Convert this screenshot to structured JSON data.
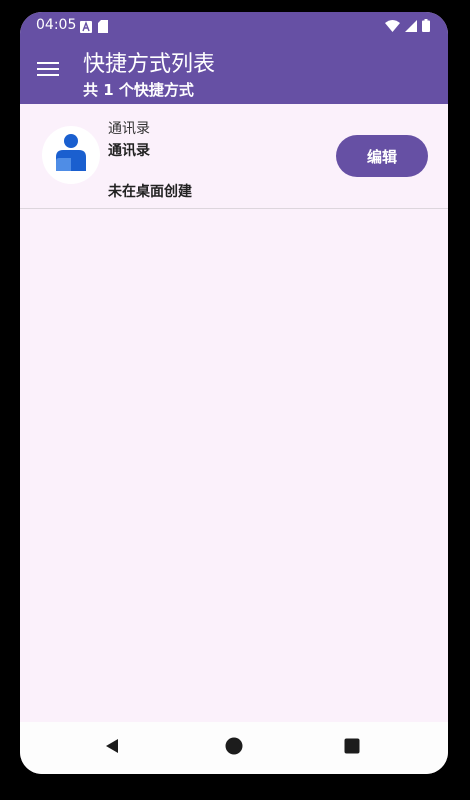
{
  "status_bar": {
    "time": "04:05",
    "left_icons": [
      "font-notification-icon",
      "sd-card-icon"
    ],
    "right_icons": [
      "wifi-icon",
      "signal-icon",
      "battery-icon"
    ]
  },
  "header": {
    "title": "快捷方式列表",
    "subtitle": "共 1 个快捷方式",
    "menu_icon": "hamburger-menu-icon",
    "color": "#6650a4"
  },
  "shortcuts": [
    {
      "icon": "contacts-person-icon",
      "app_name": "通讯录",
      "label": "通讯录",
      "status": "未在桌面创建",
      "edit_label": "编辑"
    }
  ],
  "nav_bar": {
    "buttons": [
      "back-icon",
      "home-icon",
      "recents-icon"
    ]
  },
  "colors": {
    "accent": "#6650a4",
    "background": "#fbf1fb",
    "icon_blue": "#1a5fcf",
    "icon_light_blue": "#4f8de6"
  }
}
